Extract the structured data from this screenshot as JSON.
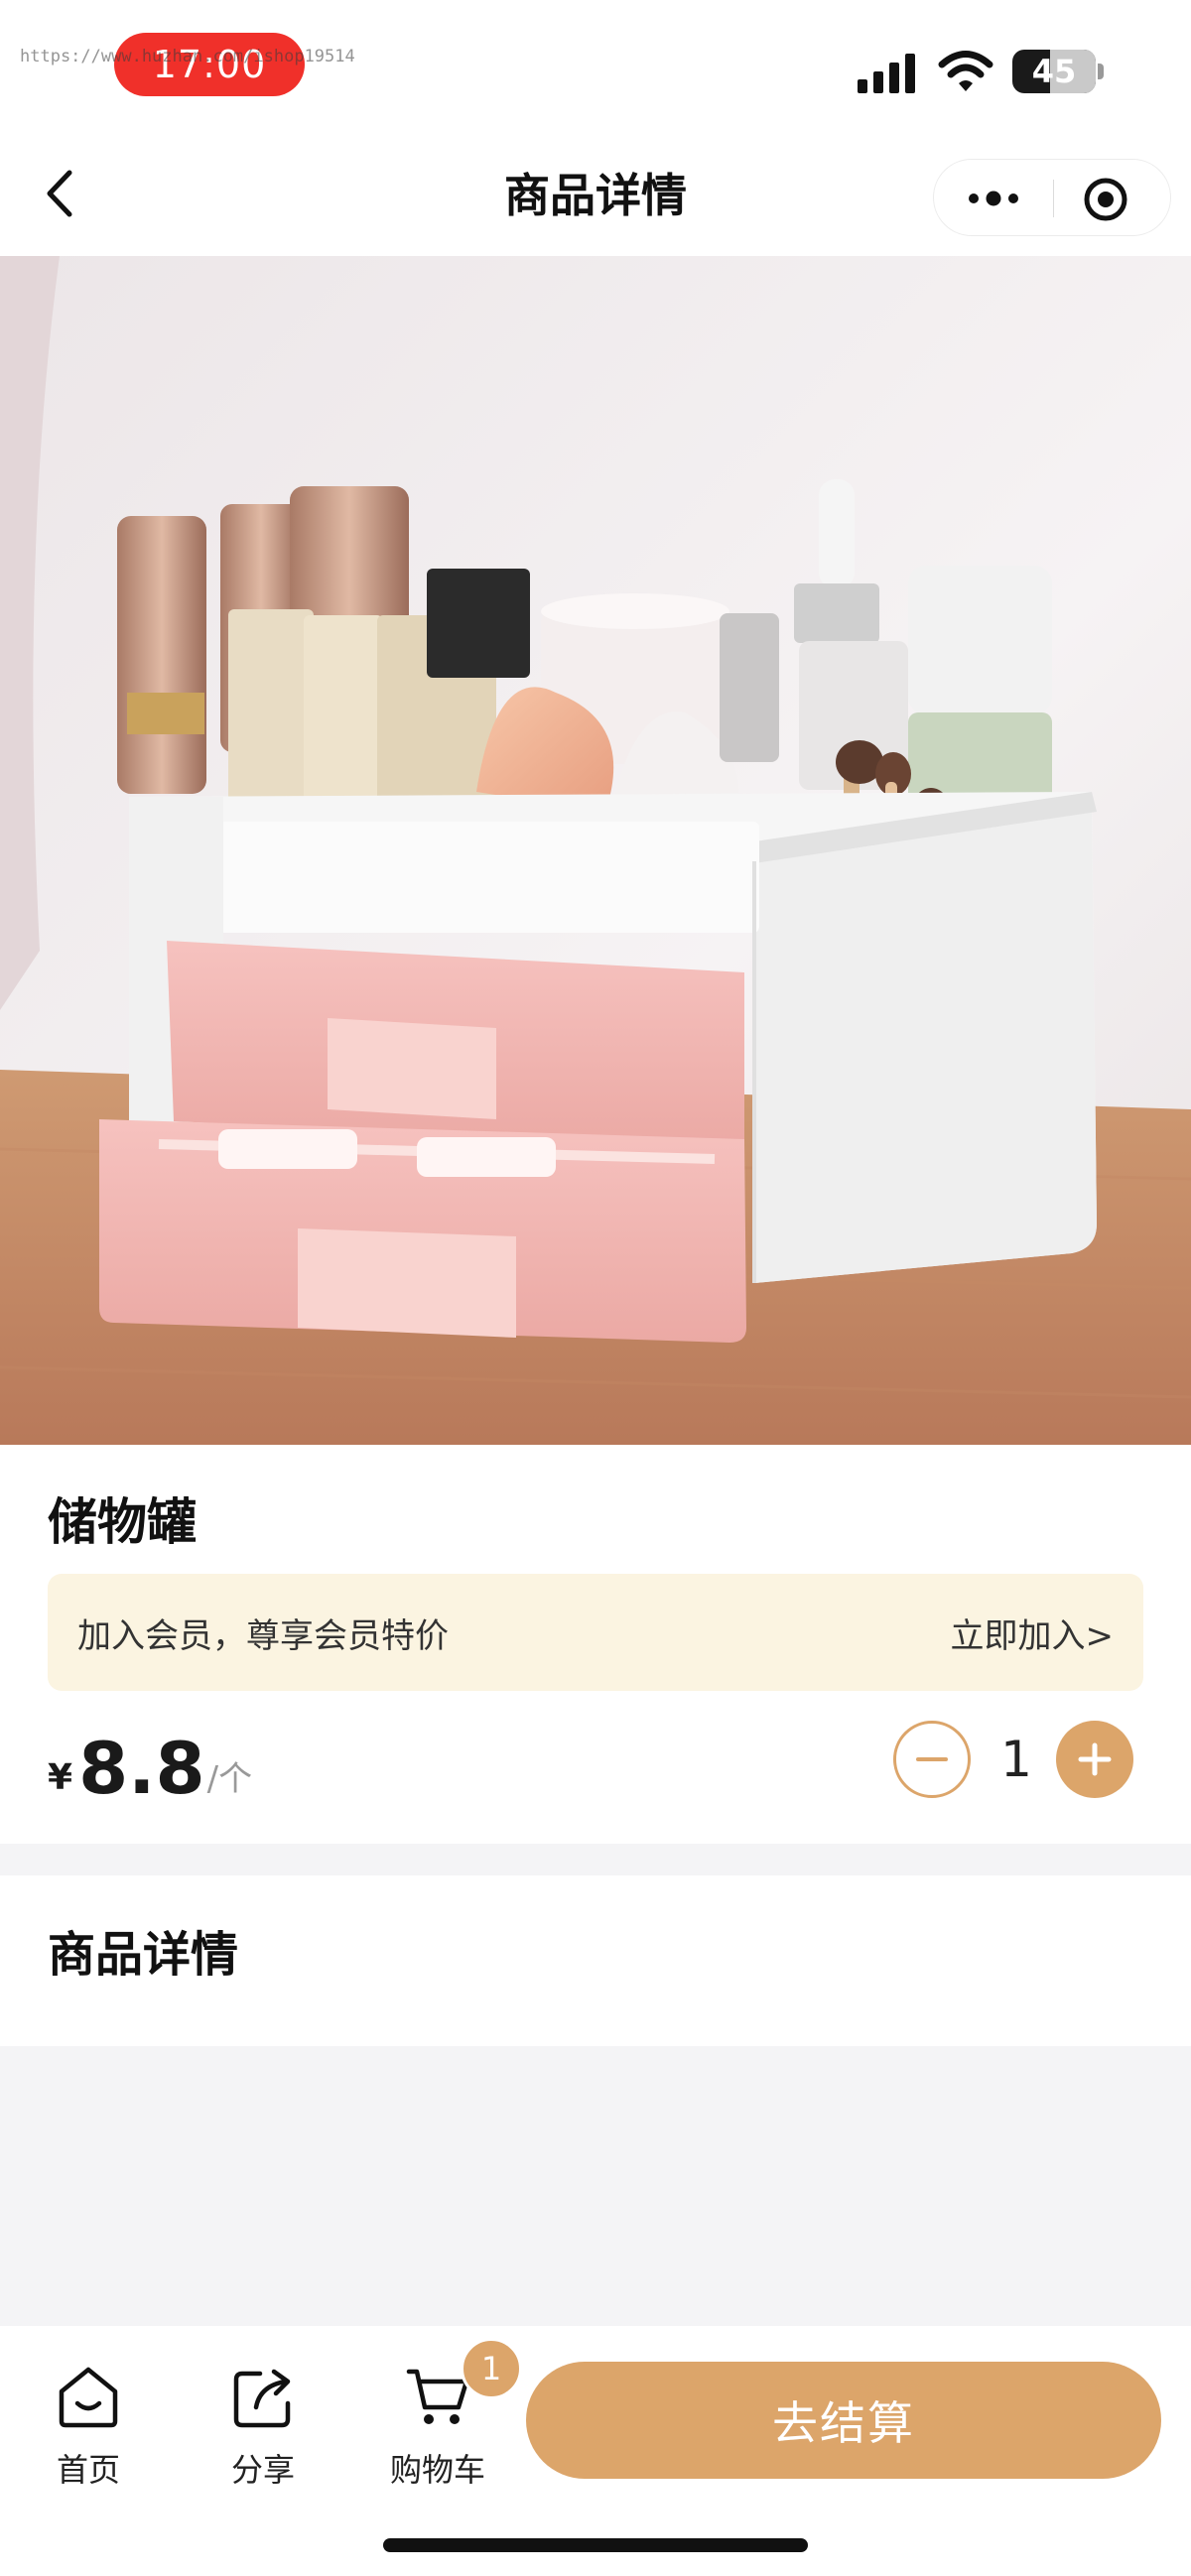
{
  "status_bar": {
    "time": "17:00",
    "watermark": "https://www.huzhan.com/ishop19514",
    "battery": "45",
    "battery_level": 0.45,
    "icons": [
      "signal-icon",
      "wifi-icon",
      "battery-icon"
    ]
  },
  "nav": {
    "title": "商品详情",
    "icons": [
      "back-icon",
      "more-icon",
      "target-icon"
    ]
  },
  "product": {
    "name": "储物罐",
    "member_text": "加入会员，尊享会员特价",
    "member_join": "立即加入>",
    "price_symbol": "¥",
    "price": "8.8",
    "unit": "/个",
    "quantity": "1"
  },
  "detail": {
    "title": "商品详情"
  },
  "bottom": {
    "tabs": [
      {
        "label": "首页",
        "icon": "home-icon"
      },
      {
        "label": "分享",
        "icon": "share-icon"
      },
      {
        "label": "购物车",
        "icon": "cart-icon"
      }
    ],
    "cart_badge": "1",
    "checkout": "去结算"
  },
  "colors": {
    "accent": "#dca56a",
    "time_pill": "#f0302a",
    "member_banner": "#fbf4e1",
    "page_gray": "#f4f4f6"
  }
}
